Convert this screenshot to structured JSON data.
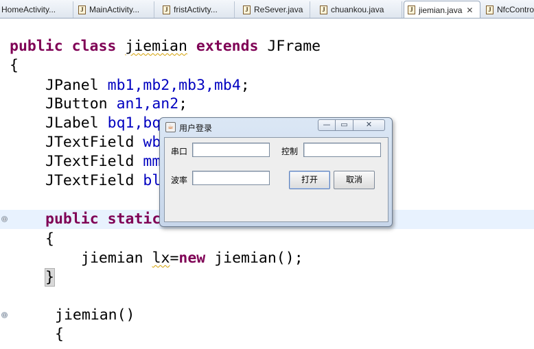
{
  "editor_tabs": [
    {
      "label": "HomeActivity...",
      "icon": "java-file-icon"
    },
    {
      "label": "MainActivity...",
      "icon": "java-file-icon"
    },
    {
      "label": "fristActivty...",
      "icon": "java-file-icon"
    },
    {
      "label": "ReSever.java",
      "icon": "java-file-icon"
    },
    {
      "label": "chuankou.java",
      "icon": "java-file-icon"
    },
    {
      "label": "jiemian.java",
      "icon": "java-file-icon",
      "active": true,
      "close": "✕"
    },
    {
      "label": "NfcContro",
      "icon": "java-file-icon"
    }
  ],
  "code": {
    "class_decl": {
      "kw1": "public",
      "kw2": "class",
      "name": "jiemian",
      "kw3": "extends",
      "super": "JFrame"
    },
    "open_brace": "{",
    "fields": [
      {
        "type": "JPanel",
        "names": "mb1,mb2,mb3,mb4",
        "end": ";"
      },
      {
        "type": "JButton",
        "names": "an1,an2",
        "end": ";"
      },
      {
        "type": "JLabel",
        "names": "bq1,bq",
        "end": ""
      },
      {
        "type": "JTextField",
        "names": "wb",
        "end": ""
      },
      {
        "type": "JTextField",
        "names": "mm",
        "end": ""
      },
      {
        "type": "JTextField",
        "names": "bl",
        "end": ""
      }
    ],
    "main_decl": {
      "kw1": "public",
      "kw2": "static"
    },
    "main_open": "{",
    "main_body": {
      "type": "jiemian",
      "var": "lx",
      "op": "=",
      "kw": "new",
      "ctor": "jiemian();"
    },
    "main_close": "}",
    "ctor_decl": "jiemian()",
    "ctor_open": "{"
  },
  "fold_markers": [
    "⊖",
    "⊖"
  ],
  "dialog": {
    "title": "用户登录",
    "app_icon": "java-cup-icon",
    "controls": {
      "minimize": "—",
      "maximize": "▭",
      "close": "✕"
    },
    "labels": {
      "serial": "串口",
      "control": "控制",
      "baud": "波率"
    },
    "fields": {
      "serial": "",
      "control": "",
      "baud": ""
    },
    "buttons": {
      "open": "打开",
      "cancel": "取消"
    }
  }
}
